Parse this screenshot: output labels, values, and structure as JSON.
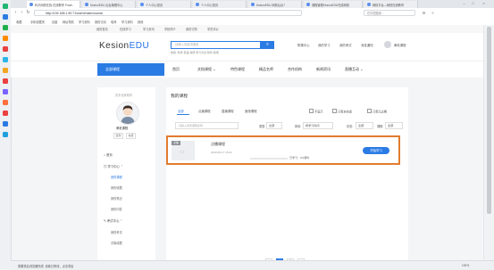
{
  "browser": {
    "tabs": [
      {
        "label": "科汛网校在线-在线教育 Powe..."
      },
      {
        "label": "KesionEDU 后台管理中心"
      },
      {
        "label": "个人中心首页"
      },
      {
        "label": "个人中心首页"
      },
      {
        "label": "KesionEDU 网校后台?"
      },
      {
        "label": "课程管理KesionEDU在线网校"
      },
      {
        "label": "网校平台—网校在线教育"
      }
    ],
    "url": "http://192.168.1.90:71/user/#/user/course",
    "search_placeholder": "在中国搜索...",
    "bookmarks": [
      "收藏",
      "手机收藏夹",
      "百度",
      "网址导航",
      "学习资料",
      "我的订阅",
      "电商",
      "学习资料",
      "其他"
    ],
    "status_text": "需要重启浏览器完成: 设置已修改，点击重启",
    "zoom": "100%"
  },
  "site": {
    "toplinks": [
      "我的首页",
      "在线学习",
      "学习资讯",
      "学校简介",
      "我的订购",
      "学员评价"
    ],
    "logo_prefix": "Kesion",
    "logo_suffix": "EDU",
    "search_placeholder": "请输入关键词搜索",
    "hotwords": "热搜: 科学  英语  考研  学习方法  软件  职场",
    "header_links": [
      "购课中心",
      "我的学习",
      "我的考试",
      "消息通知"
    ],
    "username_top": "黄老课程",
    "nav": {
      "all_courses": "全部课程",
      "items": [
        "首页",
        "文档课程 ⌄",
        "特色课程",
        "精品名师",
        "合作机构",
        "新闻资讯",
        "直播互动 ⌄"
      ]
    }
  },
  "profile": {
    "nickname_hint": "暂未设置昵称",
    "username": "黄老课程",
    "btn_left": "签到",
    "btn_right": "充值",
    "menu": [
      {
        "label": "首页",
        "icon": "home-icon"
      },
      {
        "label": "学习中心",
        "icon": "study-icon",
        "sub": [
          "我的课程",
          "我的收藏",
          "我的笔记",
          "我的问答"
        ]
      },
      {
        "label": "考试中心",
        "icon": "exam-icon",
        "sub": [
          "我的考试",
          "试卷收藏"
        ]
      }
    ]
  },
  "main": {
    "title": "我的课程",
    "tabs": [
      "全部",
      "点播课程",
      "直播课程",
      "面授课程"
    ],
    "checks": [
      "不显示",
      "只看未完成",
      "只看已过期"
    ],
    "keyword_placeholder": "请输入搜索课程名称",
    "filters": [
      {
        "label": "类型:",
        "value": "全部"
      },
      {
        "label": "排序:",
        "value": "按学习时间"
      },
      {
        "label": "状态:",
        "value": "全部"
      },
      {
        "label": "课程:",
        "value": "全部"
      }
    ],
    "course": {
      "badge": "点播",
      "title": "点播课程",
      "date": "2020-08-17 15:02",
      "progress": 0,
      "progress_text": "已学习：0/1课时",
      "start_label": "开始学习"
    },
    "pagination": [
      "‹",
      "1",
      "2",
      "›"
    ],
    "active_page": "1"
  }
}
